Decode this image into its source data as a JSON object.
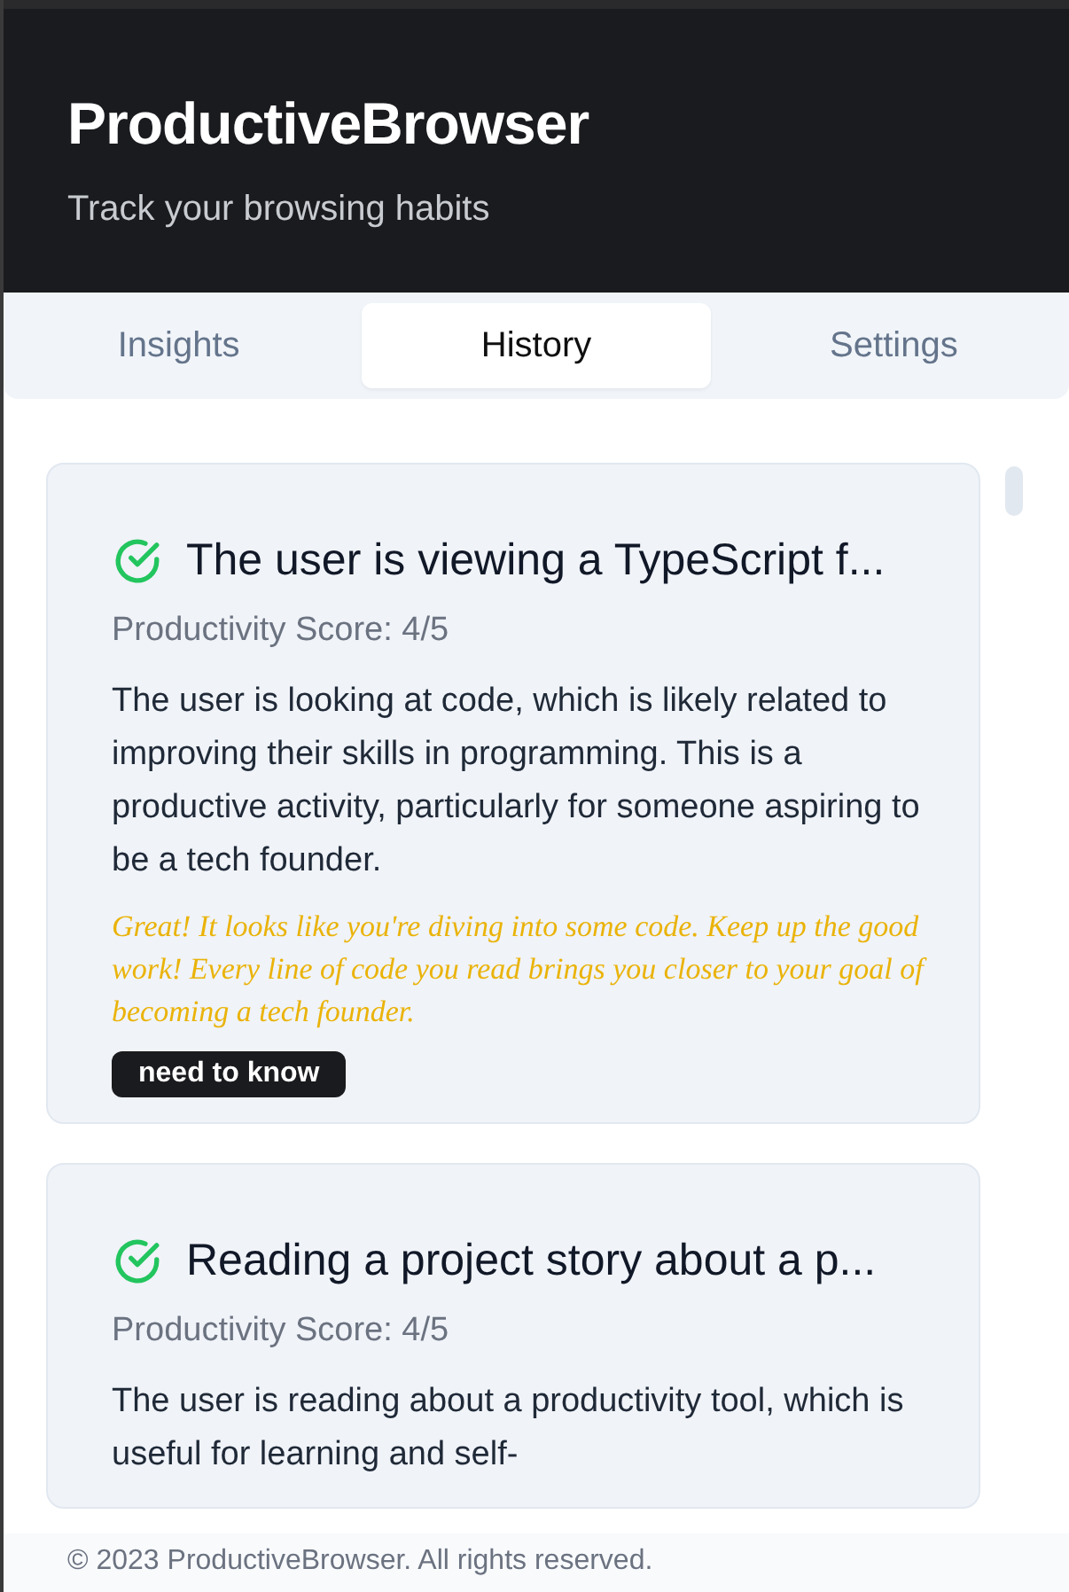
{
  "header": {
    "title": "ProductiveBrowser",
    "subtitle": "Track your browsing habits"
  },
  "tabs": [
    {
      "label": "Insights",
      "selected": false
    },
    {
      "label": "History",
      "selected": true
    },
    {
      "label": "Settings",
      "selected": false
    }
  ],
  "entries": [
    {
      "title": "The user is viewing a TypeScript f...",
      "productive": true,
      "score": "Productivity Score: 4/5",
      "summary": "The user is looking at code, which is likely related to improving their skills in programming. This is a productive activity, particularly for someone aspiring to be a tech founder.",
      "encouragement": "Great! It looks like you're diving into some code. Keep up the good work! Every line of code you read brings you closer to your goal of becoming a tech founder.",
      "tag": "need to know"
    },
    {
      "title": "Reading a project story about a p...",
      "productive": true,
      "score": "Productivity Score: 4/5",
      "summary": "The user is reading about a productivity tool, which is useful for learning and self-"
    }
  ],
  "footer": "© 2023 ProductiveBrowser. All rights reserved."
}
